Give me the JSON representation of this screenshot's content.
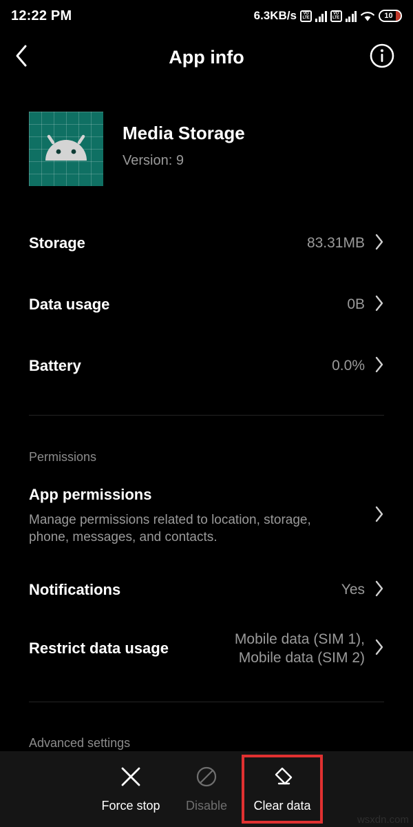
{
  "status_bar": {
    "clock": "12:22 PM",
    "net_speed": "6.3KB/s",
    "volte_top": "VO",
    "volte_bottom": "LTE",
    "battery_level": "10",
    "icons": [
      "volte-icon",
      "signal-bars-icon",
      "volte-icon",
      "signal-bars-icon",
      "wifi-icon",
      "battery-icon"
    ]
  },
  "app_bar": {
    "back_icon": "back-chevron-icon",
    "title": "App info",
    "info_icon": "info-circle-icon"
  },
  "app_header": {
    "icon_name": "android-robot-icon",
    "icon_bg": "#0f7063",
    "name": "Media Storage",
    "version": "Version: 9"
  },
  "rows": [
    {
      "label": "Storage",
      "value": "83.31MB"
    },
    {
      "label": "Data usage",
      "value": "0B"
    },
    {
      "label": "Battery",
      "value": "0.0%"
    }
  ],
  "permissions_section": {
    "header": "Permissions",
    "app_permissions": {
      "title": "App permissions",
      "description": "Manage permissions related to location, storage, phone, messages, and contacts."
    },
    "rows": [
      {
        "label": "Notifications",
        "value": "Yes"
      },
      {
        "label": "Restrict data usage",
        "value": "Mobile data (SIM 1),\nMobile data (SIM 2)"
      }
    ]
  },
  "advanced_section": {
    "header": "Advanced settings"
  },
  "bottom_bar": {
    "actions": [
      {
        "label": "Force stop",
        "icon": "close-x-icon",
        "disabled": false,
        "highlighted": false
      },
      {
        "label": "Disable",
        "icon": "block-circle-icon",
        "disabled": true,
        "highlighted": false
      },
      {
        "label": "Clear data",
        "icon": "eraser-icon",
        "disabled": false,
        "highlighted": true
      }
    ],
    "highlight_color": "#e03131"
  },
  "watermark": "wsxdn.com"
}
